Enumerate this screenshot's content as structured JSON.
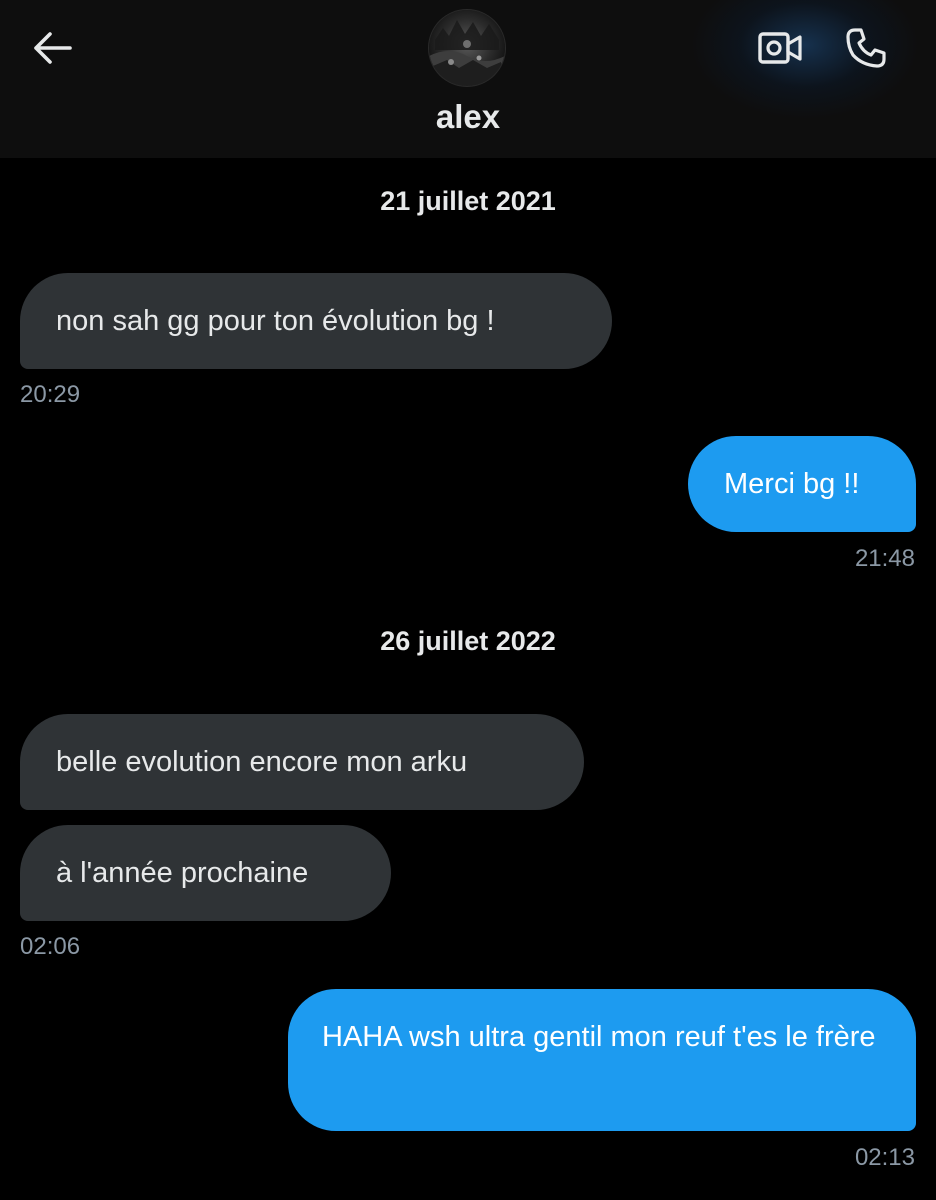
{
  "header": {
    "contact_name": "alex",
    "back_icon": "arrow-left-icon",
    "video_icon": "video-camera-icon",
    "call_icon": "phone-icon"
  },
  "colors": {
    "background": "#000000",
    "header_bg": "#0e0e0e",
    "incoming_bubble": "#2f3336",
    "outgoing_bubble": "#1d9bf0",
    "timestamp": "#8b98a5"
  },
  "conversation": {
    "dates": [
      "21 juillet 2021",
      "26 juillet 2022"
    ],
    "messages": [
      {
        "direction": "incoming",
        "text": "non sah gg pour ton évolution bg !",
        "time": "20:29"
      },
      {
        "direction": "outgoing",
        "text": "Merci bg !!",
        "time": "21:48"
      },
      {
        "direction": "incoming",
        "text": "belle evolution encore mon arku",
        "time": ""
      },
      {
        "direction": "incoming",
        "text": "à l'année prochaine",
        "time": "02:06"
      },
      {
        "direction": "outgoing",
        "text": "HAHA wsh ultra gentil mon reuf t'es le frère",
        "time": "02:13"
      }
    ]
  }
}
